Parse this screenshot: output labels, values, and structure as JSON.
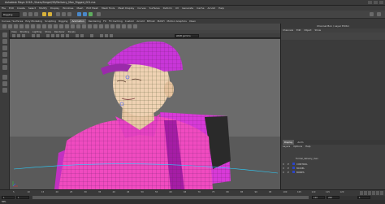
{
  "titlebar": {
    "title": "Autodesk Maya 2018: /Users/Sergei/3D/Delivery_Man_Rigged_001.ma"
  },
  "menubar": {
    "items": [
      "File",
      "Edit",
      "Create",
      "Select",
      "Modify",
      "Display",
      "Windows",
      "Mesh",
      "Edit Mesh",
      "Mesh Tools",
      "Mesh Display",
      "Curves",
      "Surfaces",
      "Deform",
      "UV",
      "Generate",
      "Cache",
      "Arnold",
      "Help"
    ]
  },
  "shelf": {
    "mode": "Rigging"
  },
  "shelf_tabs": {
    "items": [
      "Curves / Surfaces",
      "Poly Modeling",
      "Sculpting",
      "Rigging",
      "Animation",
      "Rendering",
      "FX",
      "FX Caching",
      "Custom",
      "Arnold",
      "Bifrost",
      "MASH",
      "Motion Graphics",
      "XGen"
    ],
    "active_index": 4
  },
  "panel_menu": {
    "items": [
      "View",
      "Shading",
      "Lighting",
      "Show",
      "Renderer",
      "Panels"
    ]
  },
  "view_tools": {
    "camera_field": "sRGB gamma"
  },
  "channel_box": {
    "header": "Channel Box / Layer Editor",
    "tabs": [
      "Channels",
      "Edit",
      "Object",
      "Show"
    ]
  },
  "layer_editor": {
    "tabs": [
      "Display",
      "Anim"
    ],
    "active_tab": "Display",
    "menu": [
      "Layers",
      "Options",
      "Help"
    ],
    "layer_set_name": "Formal_delivery_man",
    "layers": [
      {
        "v": "V",
        "p": "P",
        "color": "#2b45c8",
        "name": "CONTROL"
      },
      {
        "v": "V",
        "p": "P",
        "color": "#2b45c8",
        "name": "MODEL"
      },
      {
        "v": "V",
        "p": "P",
        "color": "#2b45c8",
        "name": "BONES"
      }
    ]
  },
  "timeline": {
    "ticks": [
      "5",
      "10",
      "15",
      "20",
      "25",
      "30",
      "35",
      "40",
      "45",
      "50",
      "55",
      "60",
      "65",
      "70",
      "75",
      "80",
      "85",
      "90",
      "95",
      "100",
      "105",
      "110",
      "115",
      "120"
    ]
  },
  "range": {
    "start": "1",
    "end": "120",
    "anim_start": "1",
    "anim_end": "200",
    "current_frame": "1"
  },
  "command_line": {
    "label": "MEL"
  }
}
